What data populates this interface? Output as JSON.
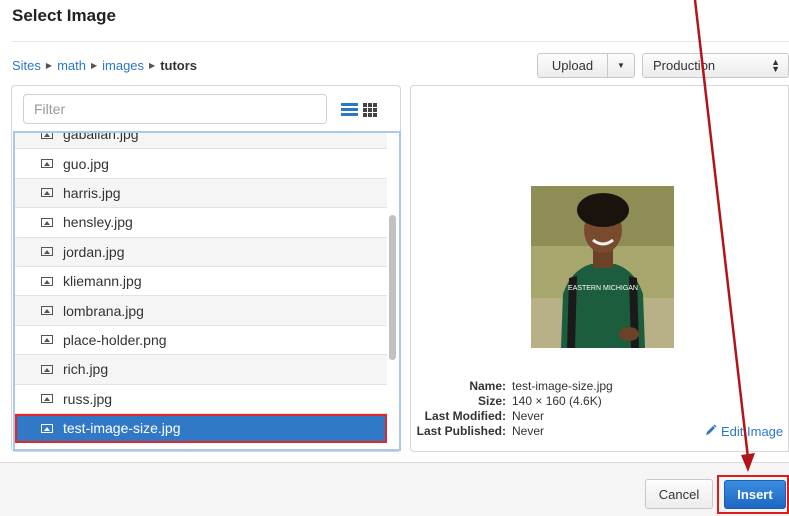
{
  "dialog": {
    "title": "Select Image"
  },
  "breadcrumb": {
    "items": [
      "Sites",
      "math",
      "images"
    ],
    "current": "tutors"
  },
  "toolbar": {
    "upload_label": "Upload",
    "environment": "Production"
  },
  "filter": {
    "placeholder": "Filter",
    "value": ""
  },
  "files": [
    {
      "name": "gaballan.jpg",
      "selected": false
    },
    {
      "name": "guo.jpg",
      "selected": false
    },
    {
      "name": "harris.jpg",
      "selected": false
    },
    {
      "name": "hensley.jpg",
      "selected": false
    },
    {
      "name": "jordan.jpg",
      "selected": false
    },
    {
      "name": "kliemann.jpg",
      "selected": false
    },
    {
      "name": "lombrana.jpg",
      "selected": false
    },
    {
      "name": "place-holder.png",
      "selected": false
    },
    {
      "name": "rich.jpg",
      "selected": false
    },
    {
      "name": "russ.jpg",
      "selected": false
    },
    {
      "name": "test-image-size.jpg",
      "selected": true
    }
  ],
  "preview": {
    "image_alt": "Student wearing green Eastern Michigan t-shirt",
    "shirt_text": "EASTERN MICHIGAN",
    "meta": [
      {
        "key": "Name:",
        "value": "test-image-size.jpg"
      },
      {
        "key": "Size:",
        "value": "140 × 160 (4.6K)"
      },
      {
        "key": "Last Modified:",
        "value": "Never"
      },
      {
        "key": "Last Published:",
        "value": "Never"
      }
    ],
    "edit_label": "Edit Image"
  },
  "footer": {
    "cancel_label": "Cancel",
    "insert_label": "Insert"
  },
  "colors": {
    "accent": "#3179c6",
    "link": "#2a77c9",
    "annotation": "#b0151a"
  }
}
